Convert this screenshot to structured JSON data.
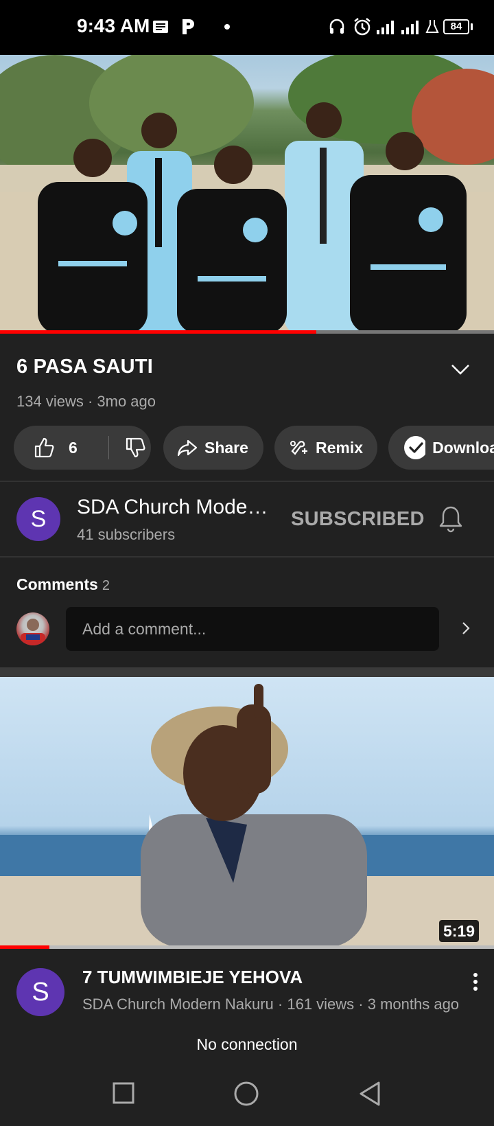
{
  "status_bar": {
    "time": "9:43 AM",
    "battery": "84",
    "icons": [
      "news-icon",
      "p-app-icon",
      "dot-icon",
      "headphones-icon",
      "alarm-icon",
      "signal-icon",
      "signal-icon",
      "lab-icon",
      "battery-icon"
    ]
  },
  "player": {
    "progress_fraction": 0.64
  },
  "video": {
    "title": "6  PASA SAUTI",
    "meta": "134 views · 3mo ago"
  },
  "actions": {
    "like_count": "6",
    "share_label": "Share",
    "remix_label": "Remix",
    "download_label": "Downloa"
  },
  "channel": {
    "avatar_letter": "S",
    "name": "SDA Church Mode…",
    "subscribers": "41 subscribers",
    "subscribe_state": "SUBSCRIBED"
  },
  "comments": {
    "heading": "Comments",
    "count": "2",
    "placeholder": "Add a comment..."
  },
  "next_video": {
    "duration": "5:19",
    "progress_fraction": 0.1,
    "avatar_letter": "S",
    "title": "7  TUMWIMBIEJE YEHOVA",
    "meta": "SDA Church Modern Nakuru · 161 views · 3 months ago"
  },
  "toast": "No connection",
  "colors": {
    "background": "#212121",
    "accent_red": "#ff0000",
    "avatar_purple": "#5e35b1",
    "secondary_text": "#aaaaaa"
  }
}
